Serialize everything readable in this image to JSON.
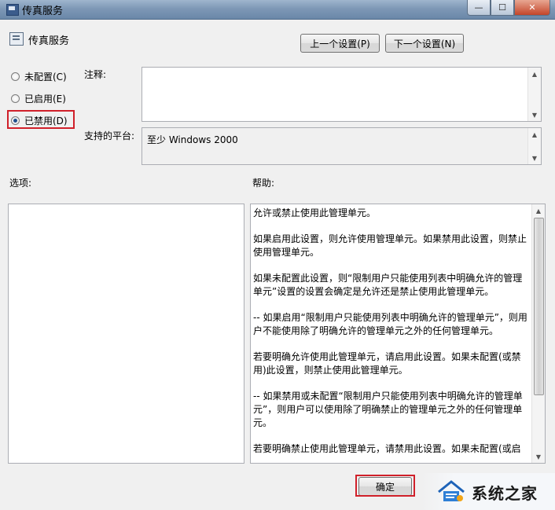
{
  "window": {
    "title": "传真服务",
    "minimize_glyph": "—",
    "maximize_glyph": "☐",
    "close_glyph": "✕"
  },
  "header": {
    "setting_name": "传真服务",
    "prev_button": "上一个设置(P)",
    "next_button": "下一个设置(N)"
  },
  "state": {
    "options": [
      {
        "label": "未配置(C)",
        "selected": false
      },
      {
        "label": "已启用(E)",
        "selected": false
      },
      {
        "label": "已禁用(D)",
        "selected": true
      }
    ]
  },
  "comment": {
    "label": "注释:",
    "value": ""
  },
  "platform": {
    "label": "支持的平台:",
    "value": "至少 Windows 2000"
  },
  "options_panel": {
    "label": "选项:"
  },
  "help": {
    "label": "帮助:",
    "paragraphs": [
      "允许或禁止使用此管理单元。",
      "如果启用此设置，则允许使用管理单元。如果禁用此设置，则禁止使用管理单元。",
      "如果未配置此设置，则“限制用户只能使用列表中明确允许的管理单元”设置的设置会确定是允许还是禁止使用此管理单元。",
      "-- 如果启用“限制用户只能使用列表中明确允许的管理单元”，则用户不能使用除了明确允许的管理单元之外的任何管理单元。",
      "若要明确允许使用此管理单元，请启用此设置。如果未配置(或禁用)此设置，则禁止使用此管理单元。",
      "-- 如果禁用或未配置“限制用户只能使用列表中明确允许的管理单元”，则用户可以使用除了明确禁止的管理单元之外的任何管理单元。",
      "若要明确禁止使用此管理单元，请禁用此设置。如果未配置(或启"
    ]
  },
  "footer": {
    "ok_button": "确定"
  },
  "watermark": {
    "text": "系统之家"
  }
}
